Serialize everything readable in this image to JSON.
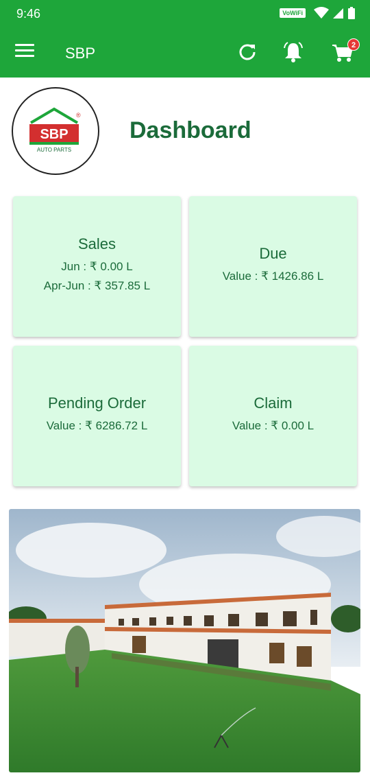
{
  "status_bar": {
    "time": "9:46",
    "vowifi": "VoWiFi"
  },
  "app_bar": {
    "title": "SBP",
    "cart_badge": "2",
    "icons": [
      "menu-icon",
      "refresh-icon",
      "bell-icon",
      "cart-icon"
    ],
    "color": "#1ea63a"
  },
  "logo": {
    "brand": "SBP",
    "tagline": "AUTO PARTS",
    "registered_mark": "®"
  },
  "page": {
    "title": "Dashboard"
  },
  "cards": {
    "sales": {
      "title": "Sales",
      "line1": "Jun : ₹ 0.00 L",
      "line2": "Apr-Jun : ₹ 357.85 L"
    },
    "due": {
      "title": "Due",
      "line1": "Value : ₹ 1426.86 L"
    },
    "pending_order": {
      "title": "Pending Order",
      "line1": "Value : ₹ 6286.72 L"
    },
    "claim": {
      "title": "Claim",
      "line1": "Value : ₹ 0.00 L"
    },
    "background": "#dafbe4",
    "text_color": "#1b6b3a"
  }
}
